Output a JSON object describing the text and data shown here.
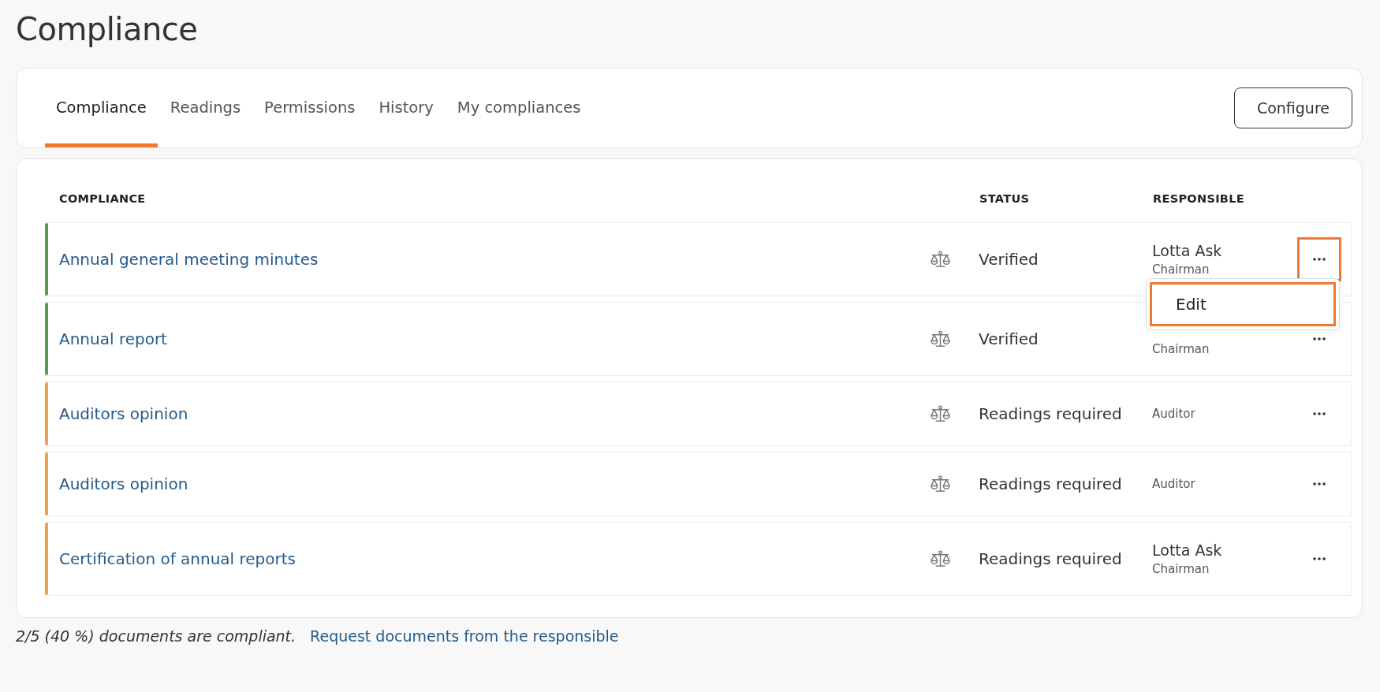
{
  "page": {
    "title": "Compliance"
  },
  "tabs": [
    {
      "label": "Compliance",
      "selected": true
    },
    {
      "label": "Readings",
      "selected": false
    },
    {
      "label": "Permissions",
      "selected": false
    },
    {
      "label": "History",
      "selected": false
    },
    {
      "label": "My compliances",
      "selected": false
    }
  ],
  "configure_button": "Configure",
  "table": {
    "columns": [
      "COMPLIANCE",
      "STATUS",
      "RESPONSIBLE"
    ],
    "rows": [
      {
        "name": "Annual general meeting minutes",
        "status": "Verified",
        "color": "#5b9a4c",
        "person": "Lotta Ask",
        "role": "Chairman",
        "menu_highlighted": true,
        "menu": {
          "items": [
            {
              "label": "Edit",
              "highlighted": true
            }
          ]
        }
      },
      {
        "name": "Annual report",
        "status": "Verified",
        "color": "#5b9a4c",
        "role": "Chairman",
        "menu_highlighted": false
      },
      {
        "name": "Auditors opinion",
        "status": "Readings required",
        "color": "#f0a24a",
        "role": "Auditor",
        "menu_highlighted": false
      },
      {
        "name": "Auditors opinion",
        "status": "Readings required",
        "color": "#f0a24a",
        "role": "Auditor",
        "menu_highlighted": false
      },
      {
        "name": "Certification of annual reports",
        "status": "Readings required",
        "color": "#f0a24a",
        "person": "Lotta Ask",
        "role": "Chairman",
        "menu_highlighted": false
      }
    ]
  },
  "footer": {
    "summary": "2/5 (40 %) documents are compliant.",
    "link": "Request documents from the responsible"
  }
}
